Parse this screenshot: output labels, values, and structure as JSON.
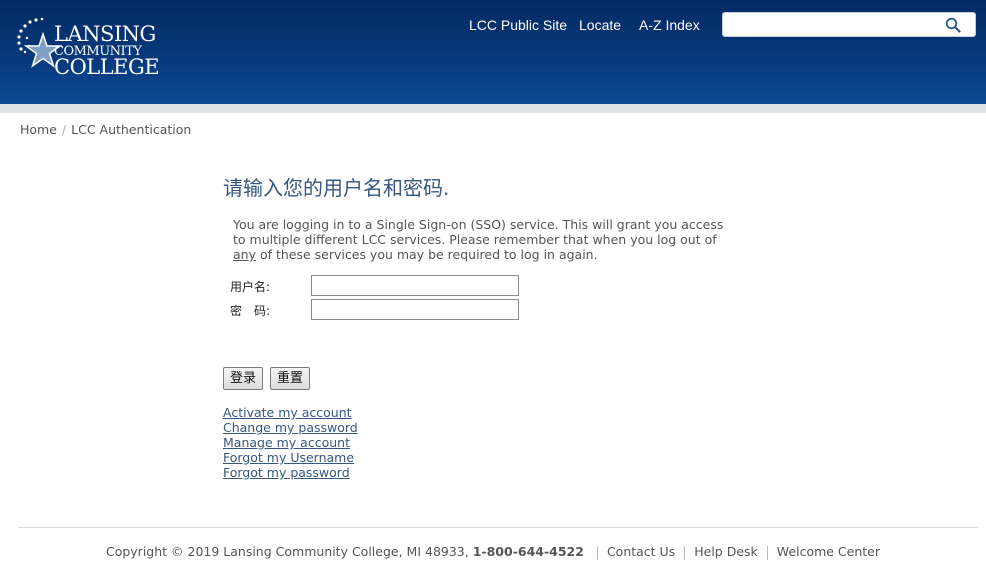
{
  "header": {
    "logo": {
      "line1": "LANSING",
      "line2": "COMMUNITY",
      "line3": "COLLEGE"
    },
    "nav": [
      {
        "label": "LCC Public Site"
      },
      {
        "label": "Locate"
      },
      {
        "label": "A-Z Index"
      }
    ],
    "search": {
      "placeholder": "",
      "value": "",
      "icon": "search-icon"
    }
  },
  "breadcrumb": {
    "home": "Home",
    "separator": "/",
    "current": "LCC Authentication"
  },
  "login": {
    "title": "请输入您的用户名和密码.",
    "intro_part1": "You are logging in to a Single Sign-on (SSO) service. This will grant you access to multiple different LCC services. Please remember that when you log out of ",
    "intro_emph": "any",
    "intro_part2": " of these services you may be required to log in again.",
    "username_label": "用户名:",
    "password_label": "密　码:",
    "username_value": "",
    "password_value": "",
    "submit_label": "登录",
    "reset_label": "重置"
  },
  "links": [
    {
      "label": "Activate my account"
    },
    {
      "label": "Change my password"
    },
    {
      "label": "Manage my account"
    },
    {
      "label": "Forgot my Username"
    },
    {
      "label": "Forgot my password"
    }
  ],
  "footer": {
    "copyright": "Copyright © 2019 Lansing Community College, MI 48933,",
    "phone": "1-800-644-4522",
    "contact": "Contact Us",
    "helpdesk": "Help Desk",
    "welcome": "Welcome Center"
  },
  "colors": {
    "header_bg": "#073a7d",
    "link": "#36587f",
    "title": "#36587f"
  }
}
